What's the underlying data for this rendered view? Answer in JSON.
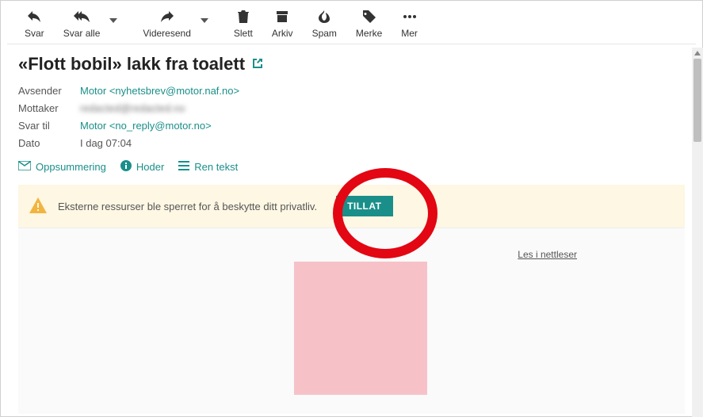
{
  "toolbar": {
    "reply": "Svar",
    "reply_all": "Svar alle",
    "forward": "Videresend",
    "delete": "Slett",
    "archive": "Arkiv",
    "spam": "Spam",
    "mark": "Merke",
    "more": "Mer"
  },
  "subject": "«Flott bobil» lakk fra toalett",
  "headers": {
    "sender_label": "Avsender",
    "sender_value": "Motor <nyhetsbrev@motor.naf.no>",
    "recipient_label": "Mottaker",
    "recipient_value": "redacted@redacted.no",
    "replyto_label": "Svar til",
    "replyto_value": "Motor <no_reply@motor.no>",
    "date_label": "Dato",
    "date_value": "I dag 07:04"
  },
  "meta_actions": {
    "summary": "Oppsummering",
    "headers": "Hoder",
    "plaintext": "Ren tekst"
  },
  "blocked": {
    "message": "Eksterne ressurser ble sperret for å beskytte ditt privatliv.",
    "allow": "TILLAT"
  },
  "body": {
    "read_in_browser": "Les i nettleser"
  }
}
